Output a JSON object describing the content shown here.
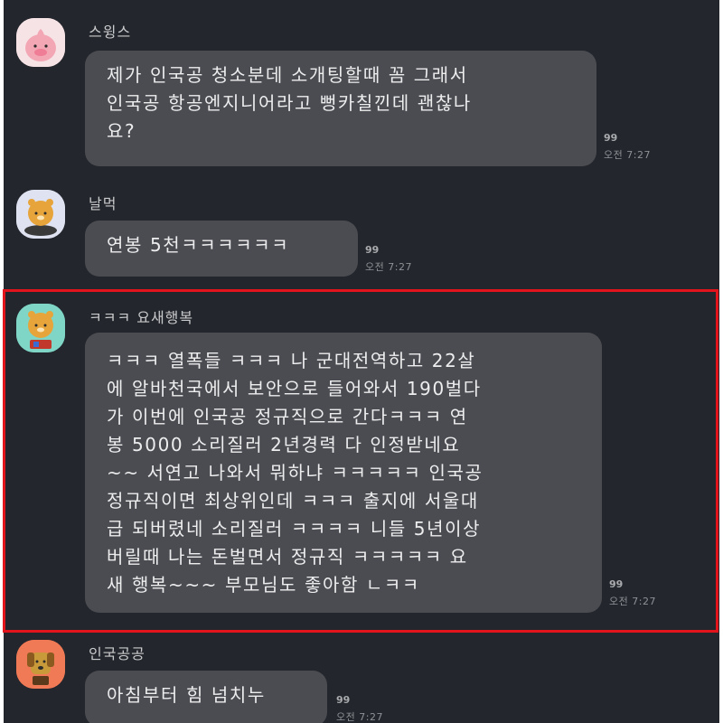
{
  "messages": [
    {
      "sender": "스윙스",
      "avatar_icon": "peach-character-avatar-icon",
      "avatar_bg": "#f6e3e6",
      "text": "제가 인국공 청소분데 소개팅할때 꼼 그래서\n인국공 항공엔지니어라고 뻥카칠낀데 괜찮나\n요?",
      "reads": "99",
      "time": "오전 7:27"
    },
    {
      "sender": "날먹",
      "avatar_icon": "lion-character-avatar-icon",
      "avatar_bg": "#dfe2f0",
      "text": "연봉 5천ㅋㅋㅋㅋㅋㅋ",
      "reads": "99",
      "time": "오전 7:27"
    },
    {
      "sender": "ㅋㅋㅋ 요새행복",
      "avatar_icon": "lion-character-avatar-icon",
      "avatar_bg": "#7fd6c6",
      "text": "ㅋㅋㅋ 열폭들 ㅋㅋㅋ 나 군대전역하고 22살\n에 알바천국에서 보안으로 들어와서 190벌다\n가 이번에 인국공 정규직으로 간다ㅋㅋㅋ 연\n봉 5000 소리질러 2년경력 다 인정받네요\n~~ 서연고 나와서 뭐하냐 ㅋㅋㅋㅋㅋ 인국공\n정규직이면 최상위인데 ㅋㅋㅋ 출지에 서울대\n급 되버렸네 소리질러 ㅋㅋㅋㅋ 니들 5년이상\n버릴때 나는 돈벌면서 정규직 ㅋㅋㅋㅋㅋ 요\n새 행복~~~ 부모님도 좋아함 ㄴㅋㅋ",
      "reads": "99",
      "time": "오전 7:27"
    },
    {
      "sender": "인국공공",
      "avatar_icon": "dog-character-avatar-icon",
      "avatar_bg": "#f07a56",
      "text": "아침부터 힘 넘치누",
      "reads": "99",
      "time": "오전 7:27"
    }
  ],
  "highlight_color": "#e3141b"
}
